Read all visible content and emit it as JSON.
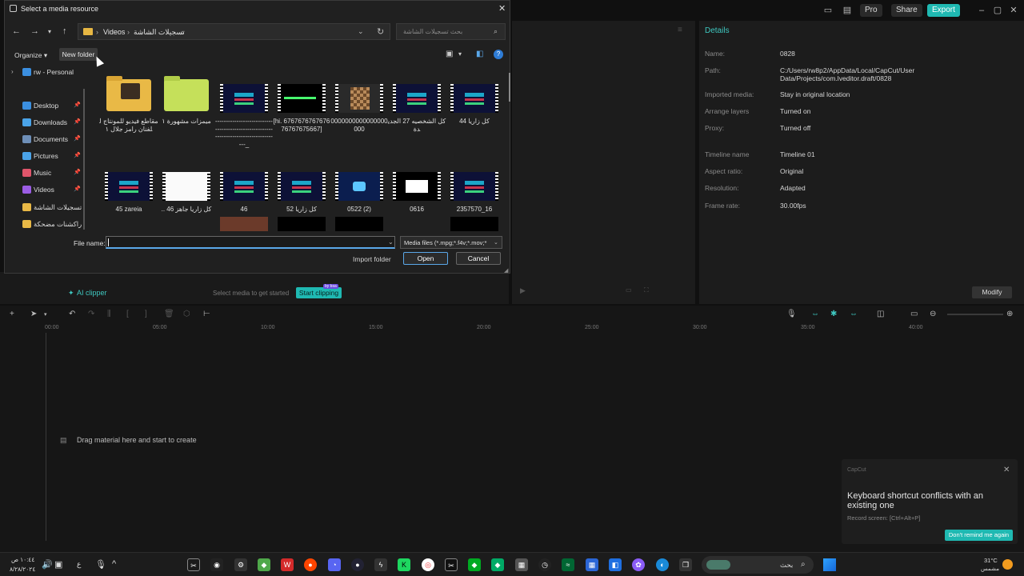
{
  "dialog": {
    "title": "Select a media resource",
    "breadcrumb": [
      "Videos",
      "تسجيلات الشاشة"
    ],
    "search_placeholder": "بحث تسجيلات الشاشة",
    "organize_label": "Organize",
    "new_folder_label": "New folder",
    "nav": [
      {
        "label": "rw - Personal",
        "icon": "cloud-icon",
        "color": "#3b8fe0"
      },
      {
        "label": "Desktop",
        "icon": "desktop-icon",
        "color": "#3b8fe0"
      },
      {
        "label": "Downloads",
        "icon": "download-icon",
        "color": "#4aa3e8"
      },
      {
        "label": "Documents",
        "icon": "document-icon",
        "color": "#6e8fb8"
      },
      {
        "label": "Pictures",
        "icon": "pictures-icon",
        "color": "#4aa3e8"
      },
      {
        "label": "Music",
        "icon": "music-icon",
        "color": "#e0556b"
      },
      {
        "label": "Videos",
        "icon": "videos-icon",
        "color": "#9b5de5"
      },
      {
        "label": "تسجيلات الشاشة",
        "icon": "folder-icon",
        "color": "#e9b946"
      },
      {
        "label": "راكشنات مضحكة",
        "icon": "folder-icon",
        "color": "#e9b946"
      }
    ],
    "files_row1": [
      {
        "name": "مقاطع فيديو للمونتاج للفنان رامز جلال ١",
        "kind": "folder-yellow"
      },
      {
        "name": "ميمزات مشهورة ١",
        "kind": "folder-green"
      },
      {
        "name": "------------------------------------------------------------------------------------_",
        "kind": "video-blue"
      },
      {
        "name": "[hi. 676767676767676767675667]",
        "kind": "video-greenbar"
      },
      {
        "name": "0000000000000000000",
        "kind": "video-chess"
      },
      {
        "name": "كل الشخصيه 27 الجديدة",
        "kind": "video-blue"
      },
      {
        "name": "كل زاريا 44",
        "kind": "video-blue"
      }
    ],
    "files_row2": [
      {
        "name": "45 zareia",
        "kind": "video-blue"
      },
      {
        "name": "كل زاريا جاهز 46 ..",
        "kind": "video-white"
      },
      {
        "name": "46",
        "kind": "video-blue"
      },
      {
        "name": "كل زاريا 52",
        "kind": "video-blue"
      },
      {
        "name": "0522 (2)",
        "kind": "video-game"
      },
      {
        "name": "0616",
        "kind": "video-whiteblock"
      },
      {
        "name": "2357570_16",
        "kind": "video-blue"
      }
    ],
    "filename_label": "File name:",
    "filename_value": "",
    "filetype_value": "Media files (*.mpg;*.f4v;*.mov;*",
    "import_folder_label": "Import folder",
    "open_label": "Open",
    "cancel_label": "Cancel"
  },
  "topbar": {
    "pro_label": "Pro",
    "share_label": "Share",
    "export_label": "Export"
  },
  "details": {
    "title": "Details",
    "rows": [
      {
        "label": "Name:",
        "value": "0828"
      },
      {
        "label": "Path:",
        "value": "C:/Users/rw8p2/AppData/Local/CapCut/User Data/Projects/com.lveditor.draft/0828"
      },
      {
        "label": "Imported media:",
        "value": "Stay in original location"
      },
      {
        "label": "Arrange layers",
        "value": "Turned on"
      },
      {
        "label": "Proxy:",
        "value": "Turned off"
      },
      {
        "label": "Timeline name",
        "value": "Timeline 01"
      },
      {
        "label": "Aspect ratio:",
        "value": "Original"
      },
      {
        "label": "Resolution:",
        "value": "Adapted"
      },
      {
        "label": "Frame rate:",
        "value": "30.00fps"
      }
    ],
    "modify_label": "Modify"
  },
  "media": {
    "ai_clipper_label": "AI clipper",
    "hint": "Select media to get started",
    "start_clipping_label": "Start clipping",
    "by_badge": "by bsa"
  },
  "timeline": {
    "ticks": [
      "00:00",
      "05:00",
      "10:00",
      "15:00",
      "20:00",
      "25:00",
      "30:00",
      "35:00",
      "40:00"
    ],
    "drag_hint": "Drag material here and start to create"
  },
  "toast": {
    "app": "CapCut",
    "title": "Keyboard shortcut conflicts with an existing one",
    "sub": "Record screen: [Ctrl+Alt+P]",
    "button": "Don't remind me again"
  },
  "taskbar": {
    "time": "١٠:٤٤ ص",
    "date": "٨/٢٨/٢٠٢٤",
    "weather_temp": "31°C",
    "weather_desc": "مشمس",
    "search_text": "بحث",
    "lang": "ع"
  },
  "colors": {
    "accent": "#1fb9b2",
    "dialog_bg": "#202020"
  }
}
